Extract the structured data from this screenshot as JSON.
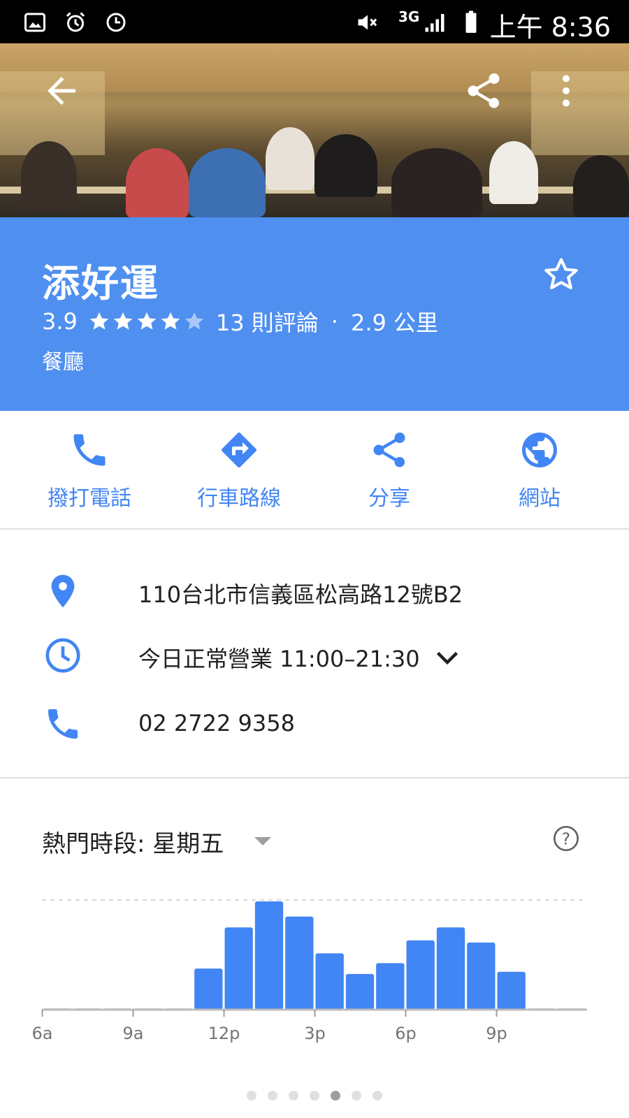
{
  "status_bar": {
    "clock": "上午 8:36",
    "network": "3G",
    "icons": [
      "gallery-icon",
      "alarm-icon",
      "timer-icon",
      "mute-icon",
      "signal-icon",
      "battery-icon"
    ]
  },
  "toolbar": {
    "back_icon": "arrow-back-icon",
    "share_icon": "share-icon",
    "overflow_icon": "more-vert-icon"
  },
  "place": {
    "name": "添好運",
    "rating": "3.9",
    "rating_value": 3.9,
    "reviews": "13 則評論",
    "separator": "·",
    "distance": "2.9 公里",
    "category": "餐廳"
  },
  "actions": [
    {
      "label": "撥打電話",
      "icon": "phone-icon"
    },
    {
      "label": "行車路線",
      "icon": "directions-icon"
    },
    {
      "label": "分享",
      "icon": "share-icon"
    },
    {
      "label": "網站",
      "icon": "globe-icon"
    }
  ],
  "info": {
    "address": "110台北市信義區松高路12號B2",
    "hours": "今日正常營業 11:00–21:30",
    "phone": "02 2722 9358"
  },
  "popular_times": {
    "title": "熱門時段: 星期五"
  },
  "chart_data": {
    "type": "bar",
    "title": "熱門時段: 星期五",
    "x_tick_labels": [
      "6a",
      "9a",
      "12p",
      "3p",
      "6p",
      "9p"
    ],
    "categories": [
      "6a",
      "7a",
      "8a",
      "9a",
      "10a",
      "11a",
      "12p",
      "1p",
      "2p",
      "3p",
      "4p",
      "5p",
      "6p",
      "7p",
      "8p",
      "9p",
      "10p",
      "11p"
    ],
    "values": [
      0,
      0,
      0,
      0,
      0,
      38,
      76,
      100,
      86,
      52,
      33,
      43,
      64,
      76,
      62,
      35,
      0,
      0
    ],
    "ylim": [
      0,
      100
    ],
    "colors": {
      "bar": "#4285f4",
      "baseline": "#bdbdbd",
      "max_line": "#d6d6d6",
      "tick_label": "#757575"
    }
  },
  "pager": {
    "count": 7,
    "active_index": 4
  },
  "colors": {
    "header_bg": "#4f8ff0",
    "accent": "#4285f4"
  }
}
